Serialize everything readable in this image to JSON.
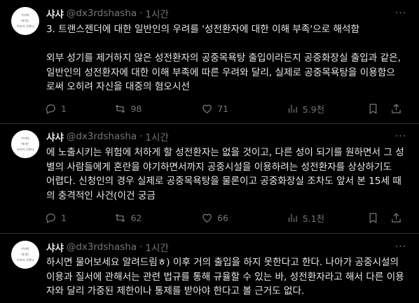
{
  "tweets": [
    {
      "name": "샤샤",
      "handle": "@dx3rdshasha",
      "dot": "·",
      "time": "1시간",
      "avatar_text": [
        "우리의",
        "마녀는",
        "우리가 구한다"
      ],
      "text": "3. 트랜스젠더에 대한 일반인의 우려를 '성전환자에 대한 이해 부족'으로 해석함\n\n외부 성기를 제거하지 않은 성전환자의 공중목욕탕 출입이라든지 공중화장실 출입과 같은,\n일반인의 성전환자에 대한 이해 부족에 따른 우려와 달리, 실제로 공중목욕탕을 이용함으\n로써 오히려 자신을 대중의 혐오시선",
      "replies": "1",
      "retweets": "98",
      "likes": "71",
      "views": "5.9천"
    },
    {
      "name": "샤샤",
      "handle": "@dx3rdshasha",
      "dot": "·",
      "time": "1시간",
      "avatar_text": [
        "우리의",
        "마녀는",
        "우리가 구한다"
      ],
      "text": "에 노출시키는 위험에 처하게 할 성전환자는 없을 것이고, 다른 성이 되기를 원하면서 그 성\n별의 사람들에게 혼란을 야기하면서까지 공중시설을 이용하려는 성전환자를 상상하기도\n어렵다. 신청인의 경우 실제로 공중목욕탕을 물론이고 공중화장실 조차도 앞서 본 15세 때\n의 충격적인 사건(이건 궁금",
      "replies": "1",
      "retweets": "62",
      "likes": "66",
      "views": "5.1천"
    },
    {
      "name": "샤샤",
      "handle": "@dx3rdshasha",
      "dot": "·",
      "time": "1시간",
      "avatar_text": [
        "우리의",
        "마녀는",
        "우리가 구한다"
      ],
      "text": "하시면 물어보세요 알려드림ㅎ) 이후 거의 출입을 하지 못한다고 한다. 나아가 공중시설의\n이용과 질서에 관해서는 관련 법규를 통해 규율할 수 있는 바, 성전환자라고 해서 다른 이용\n자와 달리 가중된 제한이나 통제를 받아야 한다고 볼 근거도 없다."
    }
  ],
  "colors": {
    "background": "#000000",
    "text": "#e7e9ea",
    "muted": "#71767b",
    "divider": "#2f3336"
  }
}
